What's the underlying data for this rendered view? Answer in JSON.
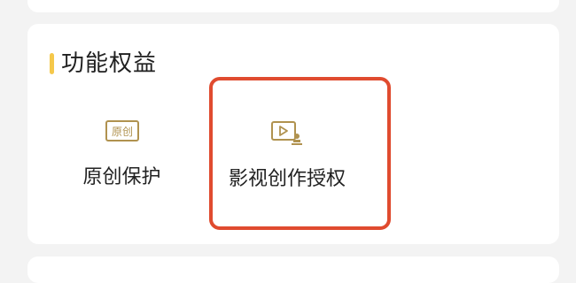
{
  "section": {
    "title": "功能权益"
  },
  "features": [
    {
      "label": "原创保护",
      "icon": "original-icon",
      "icon_text": "原创"
    },
    {
      "label": "影视创作授权",
      "icon": "video-authorization-icon"
    }
  ],
  "colors": {
    "accent": "#f5c84b",
    "icon": "#b0924f",
    "highlight": "#e04b2f",
    "card": "#ffffff",
    "background": "#f3f3f3"
  }
}
